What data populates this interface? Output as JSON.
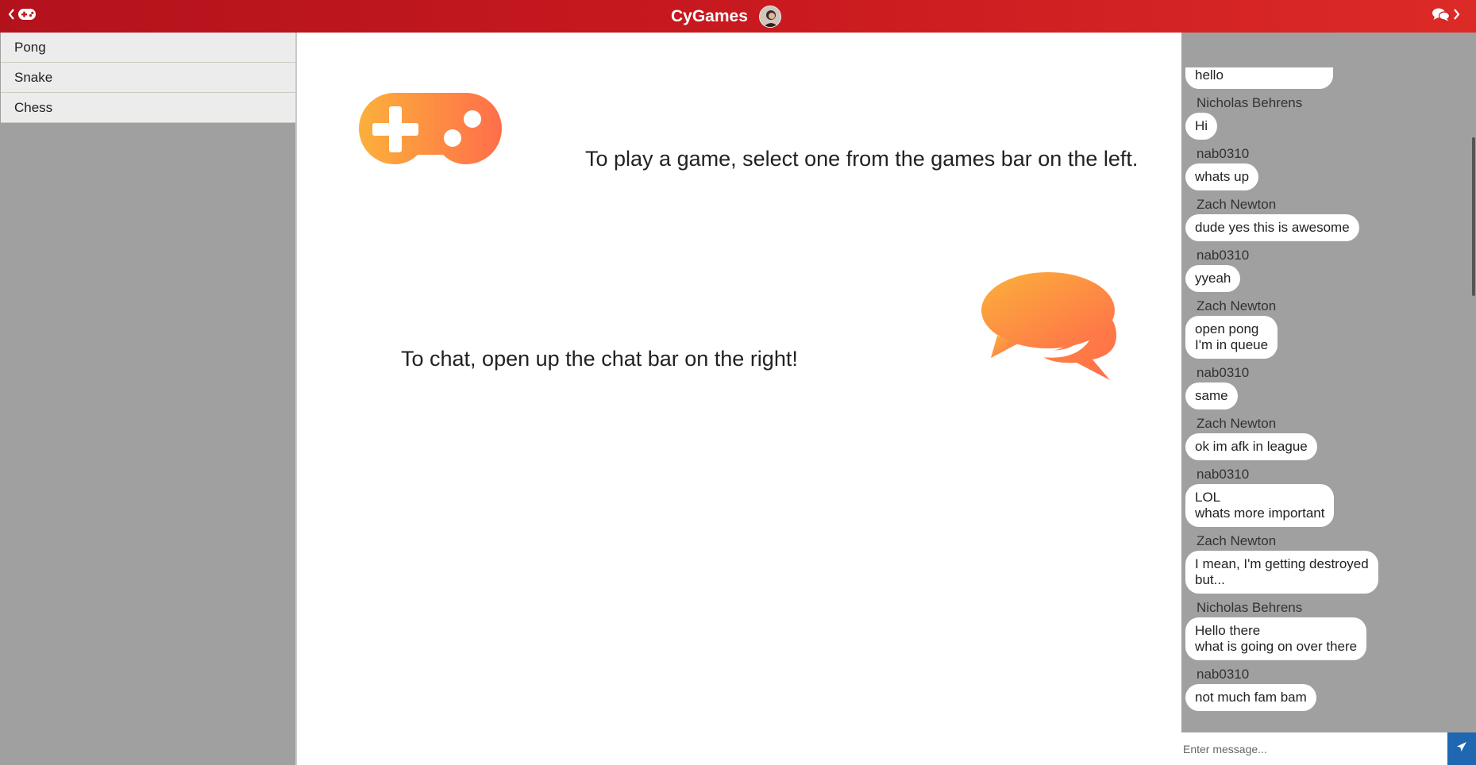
{
  "header": {
    "title": "CyGames",
    "left_toggle_icon": "gamepad-icon",
    "right_toggle_icon": "comments-icon",
    "brand_color": "#c8191f"
  },
  "games_sidebar": {
    "items": [
      {
        "label": "Pong"
      },
      {
        "label": "Snake"
      },
      {
        "label": "Chess"
      }
    ]
  },
  "main": {
    "play_instruction": "To play a game, select one from the games bar on the left.",
    "chat_instruction": "To chat, open up the chat bar on the right!",
    "gradient_start": "#fbb03b",
    "gradient_end": "#ff6e4a"
  },
  "chat": {
    "messages": [
      {
        "sender": "",
        "text": "hello"
      },
      {
        "sender": "Nicholas Behrens",
        "text": "Hi"
      },
      {
        "sender": "nab0310",
        "text": "whats up"
      },
      {
        "sender": "Zach Newton",
        "text": "dude yes this is awesome"
      },
      {
        "sender": "nab0310",
        "text": "yyeah"
      },
      {
        "sender": "Zach Newton",
        "text": "open pong\nI'm in queue"
      },
      {
        "sender": "nab0310",
        "text": "same"
      },
      {
        "sender": "Zach Newton",
        "text": "ok im afk in league"
      },
      {
        "sender": "nab0310",
        "text": "LOL\nwhats more important"
      },
      {
        "sender": "Zach Newton",
        "text": "I mean, I'm getting destroyed\nbut..."
      },
      {
        "sender": "Nicholas Behrens",
        "text": "Hello there\nwhat is going on over there"
      },
      {
        "sender": "nab0310",
        "text": "not much fam bam"
      }
    ],
    "input_placeholder": "Enter message...",
    "input_value": "",
    "send_icon": "paper-plane-icon",
    "send_color": "#1f67b0"
  }
}
